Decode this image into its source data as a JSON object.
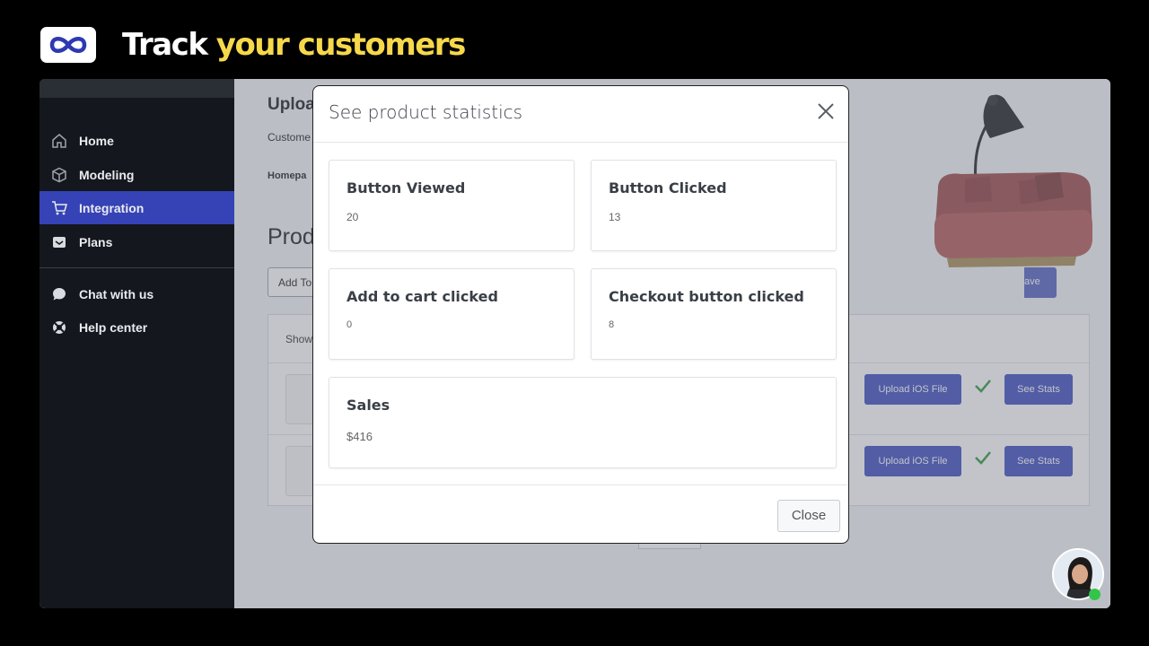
{
  "banner": {
    "headline_a": "Track",
    "headline_b": "your customers"
  },
  "sidebar": {
    "items": [
      {
        "label": "Home",
        "icon": "home-icon",
        "active": false
      },
      {
        "label": "Modeling",
        "icon": "cube-icon",
        "active": false
      },
      {
        "label": "Integration",
        "icon": "cart-icon",
        "active": true
      },
      {
        "label": "Plans",
        "icon": "inbox-icon",
        "active": false
      }
    ],
    "support": [
      {
        "label": "Chat with us",
        "icon": "chat-bubble-icon"
      },
      {
        "label": "Help center",
        "icon": "lifebuoy-icon"
      }
    ]
  },
  "background": {
    "title": "Uploa",
    "subtitle": "Custome",
    "homepage": "Homepa",
    "products": "Prod",
    "add_button": "Add To",
    "save_button": "ave",
    "show_label": "Show",
    "row_buttons": {
      "upload": "Upload iOS File",
      "stats": "See Stats"
    }
  },
  "modal": {
    "title": "See product statistics",
    "close_label": "Close",
    "cards": [
      {
        "title": "Button Viewed",
        "value": "20"
      },
      {
        "title": "Button Clicked",
        "value": "13"
      },
      {
        "title": "Add to cart clicked",
        "value": "0"
      },
      {
        "title": "Checkout button clicked",
        "value": "8"
      },
      {
        "title": "Sales",
        "value": "$416"
      }
    ]
  },
  "colors": {
    "accent": "#3543b6",
    "highlight": "#f6d94b",
    "sidebar": "#14171d"
  }
}
